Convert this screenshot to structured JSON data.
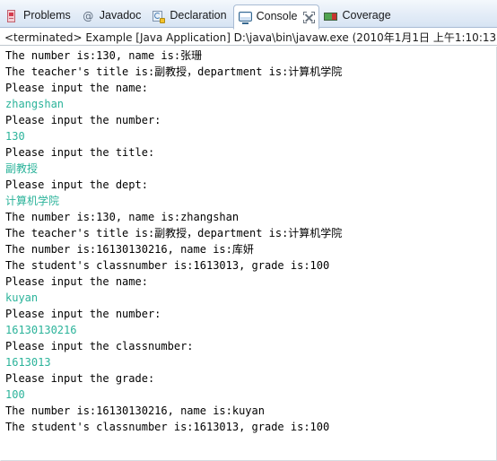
{
  "window": {
    "active_view": "Console"
  },
  "tabs": [
    {
      "label": "Problems",
      "icon": "problems-icon",
      "active": false,
      "closable": false
    },
    {
      "label": "Javadoc",
      "icon": "javadoc-icon",
      "active": false,
      "closable": false
    },
    {
      "label": "Declaration",
      "icon": "declaration-icon",
      "active": false,
      "closable": false
    },
    {
      "label": "Console",
      "icon": "console-icon",
      "active": true,
      "closable": true
    },
    {
      "label": "Coverage",
      "icon": "coverage-icon",
      "active": false,
      "closable": false
    }
  ],
  "launch": {
    "text": "<terminated> Example [Java Application] D:\\java\\bin\\javaw.exe (2010年1月1日 上午1:10:13)",
    "status": "<terminated>",
    "program": "Example",
    "launch_type": "Java Application",
    "vm_path": "D:\\java\\bin\\javaw.exe",
    "timestamp": "2010年1月1日 上午1:10:13"
  },
  "colors": {
    "stdout": "#000000",
    "stdin": "#2bb39a",
    "tab_active_bg": "#ffffff",
    "tabbar_bg": "#e6eef8"
  },
  "console": {
    "lines": [
      {
        "text": "The number is:130, name is:张珊",
        "type": "stdout"
      },
      {
        "text": "The teacher's title is:副教授，department is:计算机学院",
        "type": "stdout"
      },
      {
        "text": "Please input the name:",
        "type": "stdout"
      },
      {
        "text": "zhangshan",
        "type": "stdin"
      },
      {
        "text": "Please input the number:",
        "type": "stdout"
      },
      {
        "text": "130",
        "type": "stdin"
      },
      {
        "text": "Please input the title:",
        "type": "stdout"
      },
      {
        "text": "副教授",
        "type": "stdin"
      },
      {
        "text": "Please input the dept:",
        "type": "stdout"
      },
      {
        "text": "计算机学院",
        "type": "stdin"
      },
      {
        "text": "The number is:130, name is:zhangshan",
        "type": "stdout"
      },
      {
        "text": "The teacher's title is:副教授，department is:计算机学院",
        "type": "stdout"
      },
      {
        "text": "The number is:16130130216, name is:库妍",
        "type": "stdout"
      },
      {
        "text": "The student's classnumber is:1613013, grade is:100",
        "type": "stdout"
      },
      {
        "text": "Please input the name:",
        "type": "stdout"
      },
      {
        "text": "kuyan",
        "type": "stdin"
      },
      {
        "text": "Please input the number:",
        "type": "stdout"
      },
      {
        "text": "16130130216",
        "type": "stdin"
      },
      {
        "text": "Please input the classnumber:",
        "type": "stdout"
      },
      {
        "text": "1613013",
        "type": "stdin"
      },
      {
        "text": "Please input the grade:",
        "type": "stdout"
      },
      {
        "text": "100",
        "type": "stdin"
      },
      {
        "text": "The number is:16130130216, name is:kuyan",
        "type": "stdout"
      },
      {
        "text": "The student's classnumber is:1613013, grade is:100",
        "type": "stdout"
      }
    ]
  }
}
